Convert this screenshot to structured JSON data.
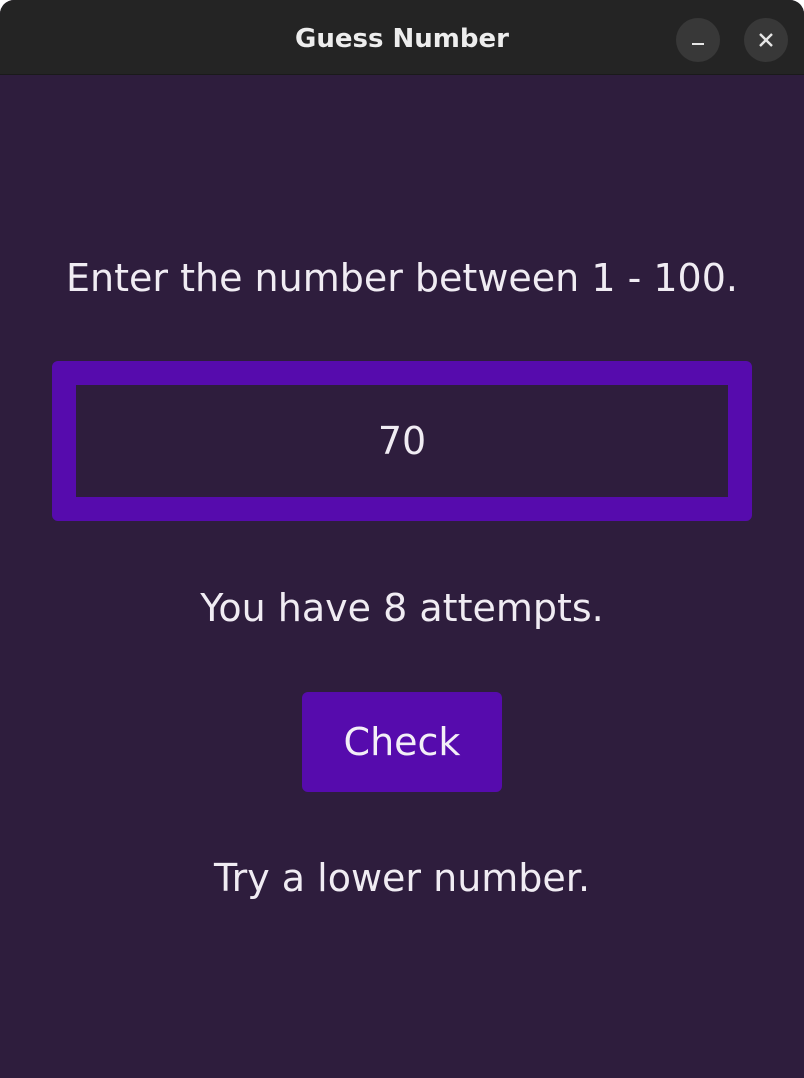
{
  "window": {
    "title": "Guess Number",
    "minimize_icon": "minimize-icon",
    "close_icon": "close-icon"
  },
  "game": {
    "prompt": "Enter the number between 1 - 100.",
    "guess_value": "70",
    "attempts_text": "You have 8 attempts.",
    "check_label": "Check",
    "feedback_text": "Try a lower number."
  },
  "colors": {
    "background": "#2e1d3d",
    "accent": "#560bad",
    "titlebar": "#242424",
    "text": "#f0ecf3"
  }
}
